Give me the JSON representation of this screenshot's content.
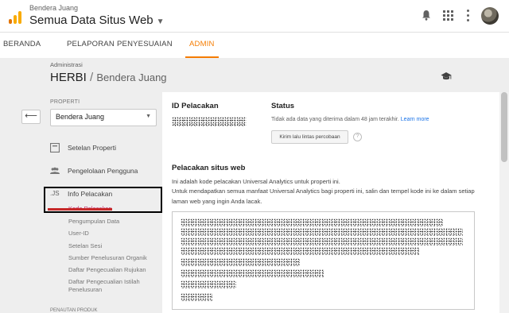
{
  "header": {
    "account_name": "Bendera Juang",
    "property_name": "Semua Data Situs Web",
    "icons": [
      "analytics-logo-icon",
      "bell-icon",
      "apps-grid-icon",
      "more-vert-icon",
      "avatar"
    ]
  },
  "nav": {
    "tabs": [
      {
        "label": "BERANDA",
        "active": false
      },
      {
        "label": "PELAPORAN",
        "active": false
      },
      {
        "label": "PENYESUAIAN",
        "active": false
      },
      {
        "label": "ADMIN",
        "active": true
      }
    ]
  },
  "page": {
    "crumb_label": "Administrasi",
    "title_main": "HERBI",
    "title_sep": "/",
    "title_sub": "Bendera Juang"
  },
  "sidebar": {
    "section_label": "PROPERTI",
    "property_select": "Bendera Juang",
    "items": [
      {
        "label": "Setelan Properti",
        "icon": "settings-square-icon"
      },
      {
        "label": "Pengelolaan Pengguna",
        "icon": "people-icon"
      },
      {
        "label": "Info Pelacakan",
        "icon": "js-icon",
        "icon_text": ".JS"
      }
    ],
    "sub_items": [
      {
        "label": "Kode Pelacakan",
        "active": true
      },
      {
        "label": "Pengumpulan Data",
        "active": false
      },
      {
        "label": "User-ID",
        "active": false
      },
      {
        "label": "Setelan Sesi",
        "active": false
      },
      {
        "label": "Sumber Penelusuran Organik",
        "active": false
      },
      {
        "label": "Daftar Pengecualian Rujukan",
        "active": false
      },
      {
        "label": "Daftar Pengecualian Istilah",
        "active": false
      }
    ],
    "sub_item_last_line2": "Penelusuran",
    "footer_label": "PENAUTAN PRODUK"
  },
  "content": {
    "tracking_id_title": "ID Pelacakan",
    "status_title": "Status",
    "status_text": "Tidak ada data yang diterima dalam 48 jam terakhir.",
    "status_link": "Learn more",
    "send_button": "Kirim lalu lintas percobaan",
    "help_symbol": "?",
    "website_tracking_title": "Pelacakan situs web",
    "desc_line1": "Ini adalah kode pelacakan Universal Analytics untuk properti ini.",
    "desc_line2": "Untuk mendapatkan semua manfaat Universal Analytics bagi properti ini, salin dan tempel kode ini ke dalam setiap",
    "desc_line3": "laman web yang ingin Anda lacak."
  },
  "colors": {
    "accent": "#f57c00",
    "link": "#1a73e8",
    "active_sub_item": "#c2185b",
    "annotation_box": "#000000",
    "annotation_underline": "#c62828"
  }
}
